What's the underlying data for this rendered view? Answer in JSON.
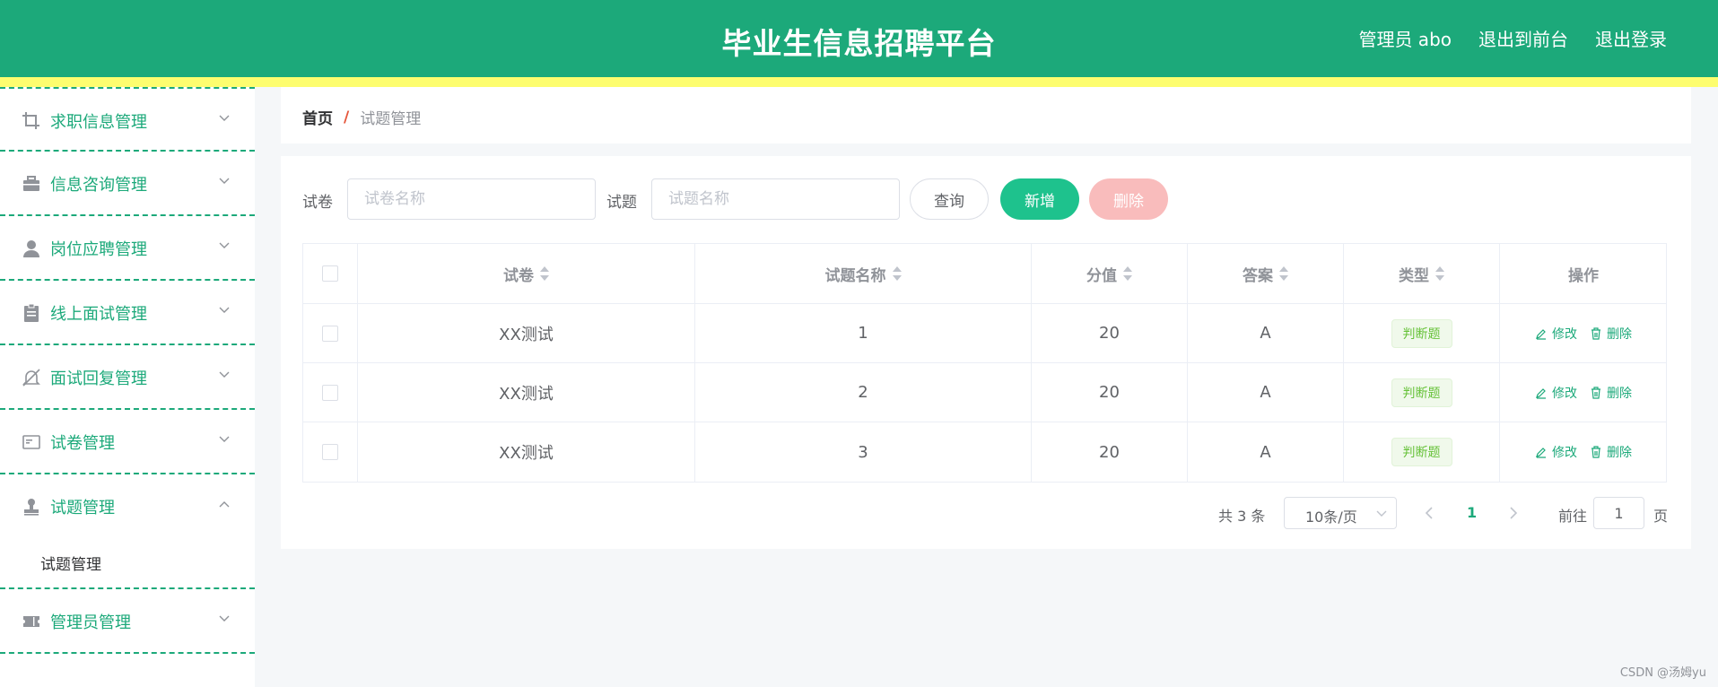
{
  "header": {
    "title": "毕业生信息招聘平台",
    "user": "管理员 abo",
    "back_to_front": "退出到前台",
    "logout": "退出登录"
  },
  "sidebar": {
    "items": [
      {
        "label": "求职信息管理",
        "icon": "crop-icon"
      },
      {
        "label": "信息咨询管理",
        "icon": "briefcase-icon"
      },
      {
        "label": "岗位应聘管理",
        "icon": "user-icon"
      },
      {
        "label": "线上面试管理",
        "icon": "clipboard-icon"
      },
      {
        "label": "面试回复管理",
        "icon": "bell-off-icon"
      },
      {
        "label": "试卷管理",
        "icon": "postcard-icon"
      },
      {
        "label": "试题管理",
        "icon": "stamp-icon",
        "expanded": true,
        "children": [
          "试题管理"
        ]
      },
      {
        "label": "管理员管理",
        "icon": "ticket-icon"
      }
    ]
  },
  "breadcrumb": {
    "home": "首页",
    "separator": "/",
    "current": "试题管理"
  },
  "search": {
    "paper_label": "试卷",
    "paper_placeholder": "试卷名称",
    "question_label": "试题",
    "question_placeholder": "试题名称",
    "query_button": "查询",
    "add_button": "新增",
    "delete_button": "删除"
  },
  "table": {
    "columns": [
      "试卷",
      "试题名称",
      "分值",
      "答案",
      "类型",
      "操作"
    ],
    "rows": [
      {
        "paper": "XX测试",
        "name": "1",
        "score": "20",
        "answer": "A",
        "type": "判断题"
      },
      {
        "paper": "XX测试",
        "name": "2",
        "score": "20",
        "answer": "A",
        "type": "判断题"
      },
      {
        "paper": "XX测试",
        "name": "3",
        "score": "20",
        "answer": "A",
        "type": "判断题"
      }
    ],
    "edit_label": "修改",
    "delete_label": "删除"
  },
  "pagination": {
    "total": "共 3 条",
    "page_size": "10条/页",
    "current_page": "1",
    "goto_label": "前往",
    "goto_value": "1",
    "page_unit": "页"
  },
  "watermark": "CSDN @汤姆yu",
  "colors": {
    "primary": "#1ca97a",
    "strip": "#fdfd6f",
    "add_button": "#1ec28d",
    "delete_button": "#f9bcbc",
    "tag_text": "#67c23a"
  }
}
